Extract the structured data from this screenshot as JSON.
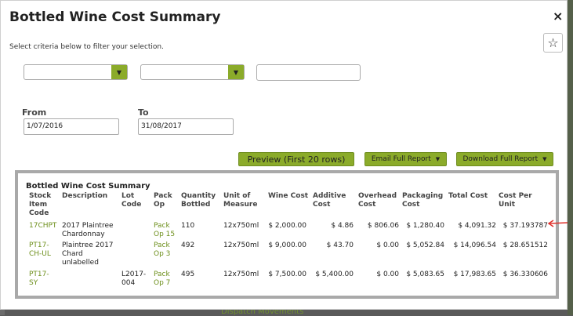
{
  "background": {
    "bottom_link": "Dispatch Movements"
  },
  "modal": {
    "title": "Bottled Wine Cost Summary",
    "close": "×",
    "favorite": "☆",
    "hint": "Select criteria below to filter your selection.",
    "from_label": "From",
    "to_label": "To",
    "from_value": "1/07/2016",
    "to_value": "31/08/2017",
    "buttons": {
      "preview": "Preview (First 20 rows)",
      "email": "Email Full Report",
      "download": "Download Full Report"
    }
  },
  "report": {
    "title": "Bottled Wine Cost Summary",
    "headers": [
      "Stock\nItem\nCode",
      "Description",
      "Lot\nCode",
      "Pack\nOp",
      "Quantity\nBottled",
      "Unit of\nMeasure",
      "Wine Cost",
      "Additive\nCost",
      "Overhead\nCost",
      "Packaging\nCost",
      "Total Cost",
      "Cost Per\nUnit"
    ],
    "rows": [
      {
        "code": "17CHPT",
        "description": "2017 Plaintree\nChardonnay",
        "lot": "",
        "pack": "Pack\nOp 15",
        "qty": "110",
        "uom": "12x750ml",
        "wine": "$ 2,000.00",
        "additive": "$ 4.86",
        "overhead": "$ 806.06",
        "packaging": "$ 1,280.40",
        "total": "$ 4,091.32",
        "per_unit": "$ 37.193787"
      },
      {
        "code": "PT17-\nCH-UL",
        "description": "Plaintree 2017\nChard\nunlabelled",
        "lot": "",
        "pack": "Pack\nOp 3",
        "qty": "492",
        "uom": "12x750ml",
        "wine": "$ 9,000.00",
        "additive": "$ 43.70",
        "overhead": "$ 0.00",
        "packaging": "$ 5,052.84",
        "total": "$ 14,096.54",
        "per_unit": "$ 28.651512"
      },
      {
        "code": "PT17-\nSY",
        "description": "",
        "lot": "L2017-\n004",
        "pack": "Pack\nOp 7",
        "qty": "495",
        "uom": "12x750ml",
        "wine": "$ 7,500.00",
        "additive": "$ 5,400.00",
        "overhead": "$ 0.00",
        "packaging": "$ 5,083.65",
        "total": "$ 17,983.65",
        "per_unit": "$ 36.330606"
      }
    ]
  },
  "colors": {
    "accent": "#8bab2a",
    "link": "#6d8f1b",
    "arrow": "#e0302a"
  }
}
